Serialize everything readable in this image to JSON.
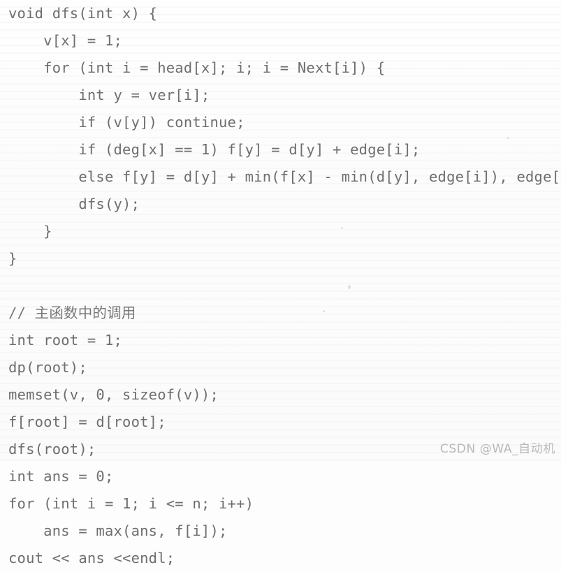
{
  "page": {
    "background_color": "#fdfdfd",
    "text_color": "#6e6e70",
    "watermark_color": "#b8b8bc"
  },
  "code": {
    "language": "cpp",
    "lines": [
      "void dfs(int x) {",
      "    v[x] = 1;",
      "    for (int i = head[x]; i; i = Next[i]) {",
      "        int y = ver[i];",
      "        if (v[y]) continue;",
      "        if (deg[x] == 1) f[y] = d[y] + edge[i];",
      "        else f[y] = d[y] + min(f[x] - min(d[y], edge[i]), edge[i]);",
      "        dfs(y);",
      "    }",
      "}",
      "",
      "// 主函数中的调用",
      "int root = 1;",
      "dp(root);",
      "memset(v, 0, sizeof(v));",
      "f[root] = d[root];",
      "dfs(root);",
      "int ans = 0;",
      "for (int i = 1; i <= n; i++)",
      "    ans = max(ans, f[i]);",
      "cout << ans <<endl;"
    ]
  },
  "watermark": {
    "text": "CSDN @WA_自动机"
  }
}
